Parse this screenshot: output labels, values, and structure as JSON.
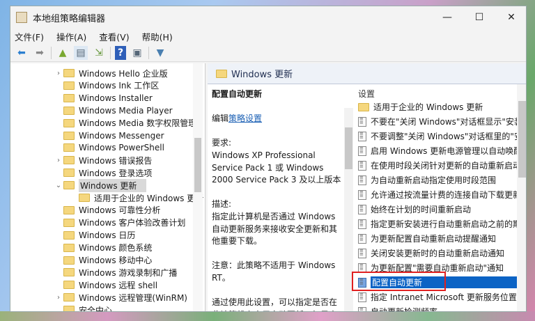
{
  "window": {
    "title": "本地组策略编辑器",
    "minimize": "—",
    "maximize": "☐",
    "close": "✕"
  },
  "menu": [
    "文件(F)",
    "操作(A)",
    "查看(V)",
    "帮助(H)"
  ],
  "tree": [
    {
      "label": "Windows Hello 企业版",
      "expander": ">"
    },
    {
      "label": "Windows Ink 工作区",
      "expander": ""
    },
    {
      "label": "Windows Installer",
      "expander": ""
    },
    {
      "label": "Windows Media Player",
      "expander": ""
    },
    {
      "label": "Windows Media 数字权限管理",
      "expander": ""
    },
    {
      "label": "Windows Messenger",
      "expander": ""
    },
    {
      "label": "Windows PowerShell",
      "expander": ""
    },
    {
      "label": "Windows 错误报告",
      "expander": ">"
    },
    {
      "label": "Windows 登录选项",
      "expander": ""
    },
    {
      "label": "Windows 更新",
      "expander": "v",
      "selected": true
    },
    {
      "label": "适用于企业的 Windows 更新",
      "expander": "",
      "child": true
    },
    {
      "label": "Windows 可靠性分析",
      "expander": ""
    },
    {
      "label": "Windows 客户体验改善计划",
      "expander": ""
    },
    {
      "label": "Windows 日历",
      "expander": ""
    },
    {
      "label": "Windows 颜色系统",
      "expander": ""
    },
    {
      "label": "Windows 移动中心",
      "expander": ""
    },
    {
      "label": "Windows 游戏录制和广播",
      "expander": ""
    },
    {
      "label": "Windows 远程 shell",
      "expander": ""
    },
    {
      "label": "Windows 远程管理(WinRM)",
      "expander": ">"
    },
    {
      "label": "安全中心",
      "expander": ""
    }
  ],
  "right": {
    "header": "Windows 更新",
    "desc": {
      "title": "配置自动更新",
      "edit_prefix": "编辑",
      "edit_link": "策略设置",
      "req_label": "要求:",
      "req_text": "Windows XP Professional Service Pack 1 或 Windows 2000 Service Pack 3 及以上版本",
      "desc_label": "描述:",
      "desc_text": "指定此计算机是否通过 Windows 自动更新服务来接收安全更新和其他重要下载。",
      "note": "注意：此策略不适用于 Windows RT。",
      "more": "通过使用此设置，可以指定是否在此计算机上启用自动更新。如果启"
    },
    "list_header": "设置",
    "items": [
      {
        "label": "适用于企业的 Windows 更新",
        "type": "folder"
      },
      {
        "label": "不要在\"关闭 Windows\"对话框显示\"安装更新并关机\"",
        "type": "policy"
      },
      {
        "label": "不要调整\"关闭 Windows\"对话框里的\"安装更新并关机\"",
        "type": "policy"
      },
      {
        "label": "启用 Windows 更新电源管理以自动唤醒",
        "type": "policy"
      },
      {
        "label": "在使用时段关闭针对更新的自动重新启动",
        "type": "policy"
      },
      {
        "label": "为自动重新启动指定使用时段范围",
        "type": "policy"
      },
      {
        "label": "允许通过按流量计费的连接自动下载更新",
        "type": "policy"
      },
      {
        "label": "始终在计划的时间重新启动",
        "type": "policy"
      },
      {
        "label": "指定更新安装进行自动重新启动之前的期限",
        "type": "policy"
      },
      {
        "label": "为更新配置自动重新启动提醒通知",
        "type": "policy"
      },
      {
        "label": "关闭安装更新时的自动重新启动通知",
        "type": "policy"
      },
      {
        "label": "为更新配置\"需要自动重新启动\"通知",
        "type": "policy"
      },
      {
        "label": "配置自动更新",
        "type": "policy",
        "selected": true
      },
      {
        "label": "指定 Intranet Microsoft 更新服务位置",
        "type": "policy"
      },
      {
        "label": "自动更新检测频率",
        "type": "policy"
      }
    ]
  }
}
